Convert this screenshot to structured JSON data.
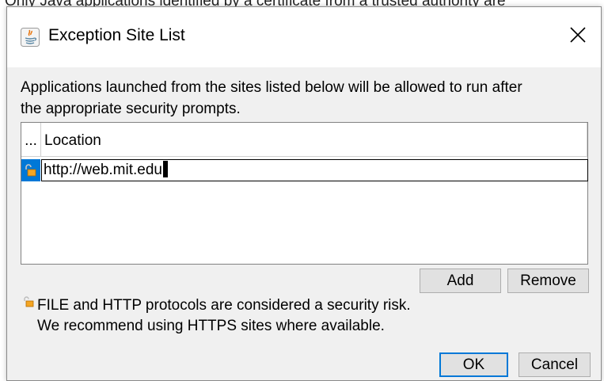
{
  "background_text": "Only Java applications identified by a certificate from a trusted authority are",
  "window": {
    "title": "Exception Site List",
    "app_icon": "java-icon",
    "close_icon": "close-icon"
  },
  "description": {
    "line1": "Applications launched from the sites listed below will be allowed to run after",
    "line2": "the appropriate security prompts."
  },
  "table": {
    "columns": [
      "...",
      "Location"
    ],
    "rows": [
      {
        "icon": "unlocked-padlock-icon",
        "location": "http://web.mit.edu",
        "selected": true
      }
    ]
  },
  "buttons": {
    "add": "Add",
    "remove": "Remove",
    "ok": "OK",
    "cancel": "Cancel"
  },
  "warning": {
    "icon": "unlocked-padlock-icon",
    "line1": "FILE and HTTP protocols are considered a security risk.",
    "line2": "We recommend using HTTPS sites where available."
  },
  "colors": {
    "selection": "#0078d7",
    "dialog_bg": "#f0f0f0",
    "button_bg": "#e1e1e1",
    "focus_border": "#0078d7"
  }
}
